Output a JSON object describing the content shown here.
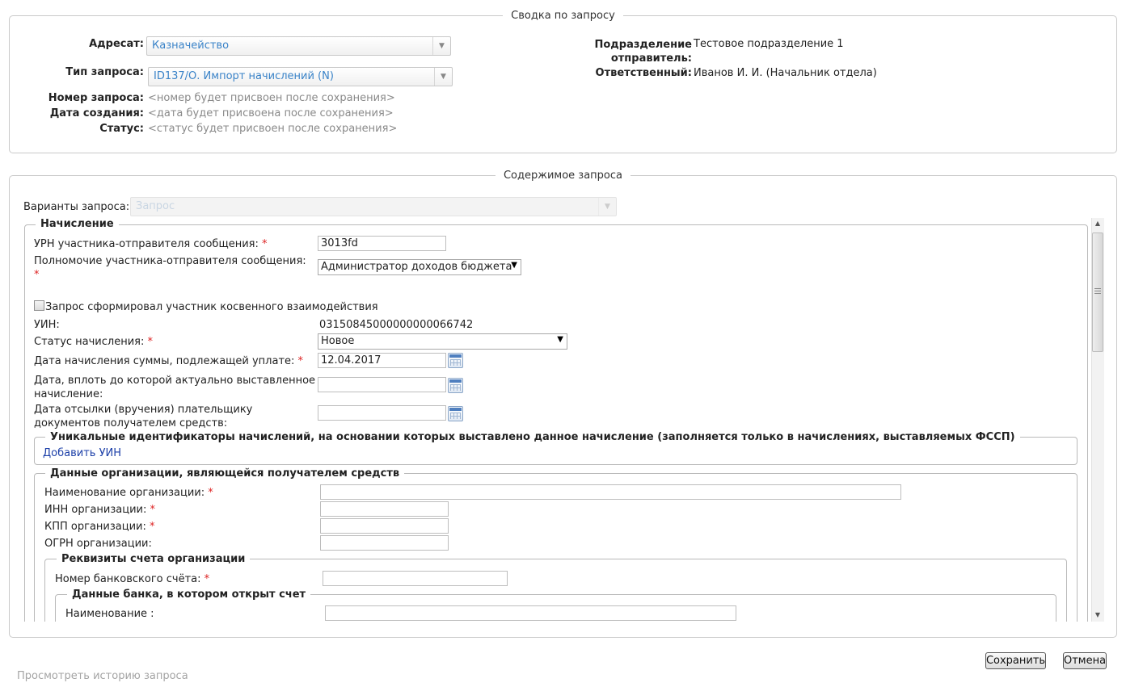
{
  "summary": {
    "title": "Сводка по запросу",
    "addressee_label": "Адресат:",
    "addressee_value": "Казначейство",
    "request_type_label": "Тип запроса:",
    "request_type_value": "ID137/О. Импорт начислений (N)",
    "request_number_label": "Номер запроса:",
    "request_number_value": "<номер будет присвоен после сохранения>",
    "created_label": "Дата создания:",
    "created_value": "<дата будет присвоена после сохранения>",
    "status_label": "Статус:",
    "status_value": "<статус будет присвоен после сохранения>",
    "department_label_1": "Подразделение",
    "department_label_2": "отправитель:",
    "department_value": "Тестовое подразделение 1",
    "responsible_label": "Ответственный:",
    "responsible_value": "Иванов И. И. (Начальник отдела)"
  },
  "content": {
    "title": "Содержимое запроса",
    "variants_label": "Варианты запроса:",
    "variants_value": "Запрос"
  },
  "accrual": {
    "legend": "Начисление",
    "urn_label": "УРН участника-отправителя сообщения:",
    "urn_value": "3013fd",
    "authority_label": "Полномочие участника-отправителя сообщения:",
    "authority_value": "Администратор доходов бюджета",
    "indirect_label": "Запрос сформировал участник косвенного взаимодействия",
    "uin_label": "УИН:",
    "uin_value": "03150845000000000066742",
    "status_label": "Статус начисления:",
    "status_value": "Новое",
    "date_label": "Дата начисления суммы, подлежащей уплате:",
    "date_value": "12.04.2017",
    "actual_label_1": "Дата, вплоть до которой актуально выставленное",
    "actual_label_2": "начисление:",
    "sent_label_1": "Дата отсылки (вручения) плательщику",
    "sent_label_2": "документов получателем средств:",
    "req_mark": "*"
  },
  "uids": {
    "legend": "Уникальные идентификаторы начислений, на основании которых выставлено данное начисление (заполняется только в начислениях, выставляемых ФССП)",
    "add_link": "Добавить УИН"
  },
  "org": {
    "legend": "Данные организации, являющейся получателем средств",
    "name_label": "Наименование организации:",
    "inn_label": "ИНН организации:",
    "kpp_label": "КПП организации:",
    "ogrn_label": "ОГРН организации:"
  },
  "account": {
    "legend": "Реквизиты счета организации",
    "number_label": "Номер банковского счёта:"
  },
  "bank": {
    "legend": "Данные банка, в котором открыт счет",
    "name_label": "Наименование :"
  },
  "footer": {
    "history_link": "Просмотреть историю запроса",
    "save_label": "Сохранить",
    "cancel_label": "Отмена"
  }
}
